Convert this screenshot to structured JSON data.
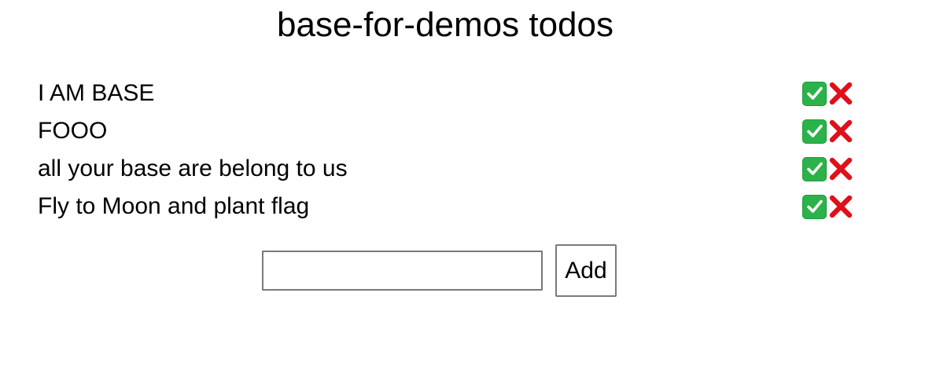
{
  "page": {
    "title": "base-for-demos todos"
  },
  "todos": [
    {
      "text": "I AM BASE",
      "complete_icon": "check-mark-button-icon",
      "delete_icon": "cross-mark-icon"
    },
    {
      "text": "FOOO",
      "complete_icon": "check-mark-button-icon",
      "delete_icon": "cross-mark-icon"
    },
    {
      "text": "all your base are belong to us",
      "complete_icon": "check-mark-button-icon",
      "delete_icon": "cross-mark-icon"
    },
    {
      "text": "Fly to Moon and plant flag",
      "complete_icon": "check-mark-button-icon",
      "delete_icon": "cross-mark-icon"
    }
  ],
  "form": {
    "input_value": "",
    "add_label": "Add"
  },
  "colors": {
    "check_green": "#2bb34a",
    "cross_red": "#e0101a",
    "border_gray": "#7a7a7a"
  }
}
